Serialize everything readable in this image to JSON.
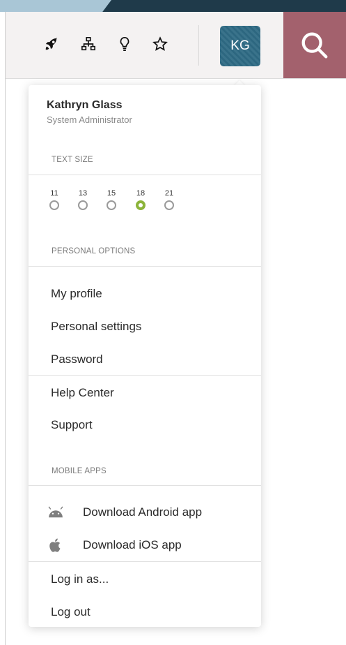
{
  "header": {
    "icons": [
      "rocket-icon",
      "hierarchy-icon",
      "lightbulb-icon",
      "star-icon"
    ],
    "avatar_initials": "KG",
    "search_icon": "search-icon",
    "colors": {
      "avatar": "#2e6a84",
      "search": "#a3616d",
      "selected_radio": "#8cb43a"
    }
  },
  "menu": {
    "user": {
      "name": "Kathryn Glass",
      "role": "System Administrator"
    },
    "text_size": {
      "title": "TEXT SIZE",
      "options": [
        "11",
        "13",
        "15",
        "18",
        "21"
      ],
      "selected": "18"
    },
    "personal": {
      "title": "PERSONAL OPTIONS",
      "items": [
        "My profile",
        "Personal settings",
        "Password"
      ]
    },
    "help": {
      "items": [
        "Help Center",
        "Support"
      ]
    },
    "mobile": {
      "title": "MOBILE APPS",
      "items": [
        {
          "icon": "android-icon",
          "label": "Download Android app"
        },
        {
          "icon": "apple-icon",
          "label": "Download iOS app"
        }
      ]
    },
    "account": {
      "items": [
        "Log in as...",
        "Log out"
      ]
    }
  }
}
